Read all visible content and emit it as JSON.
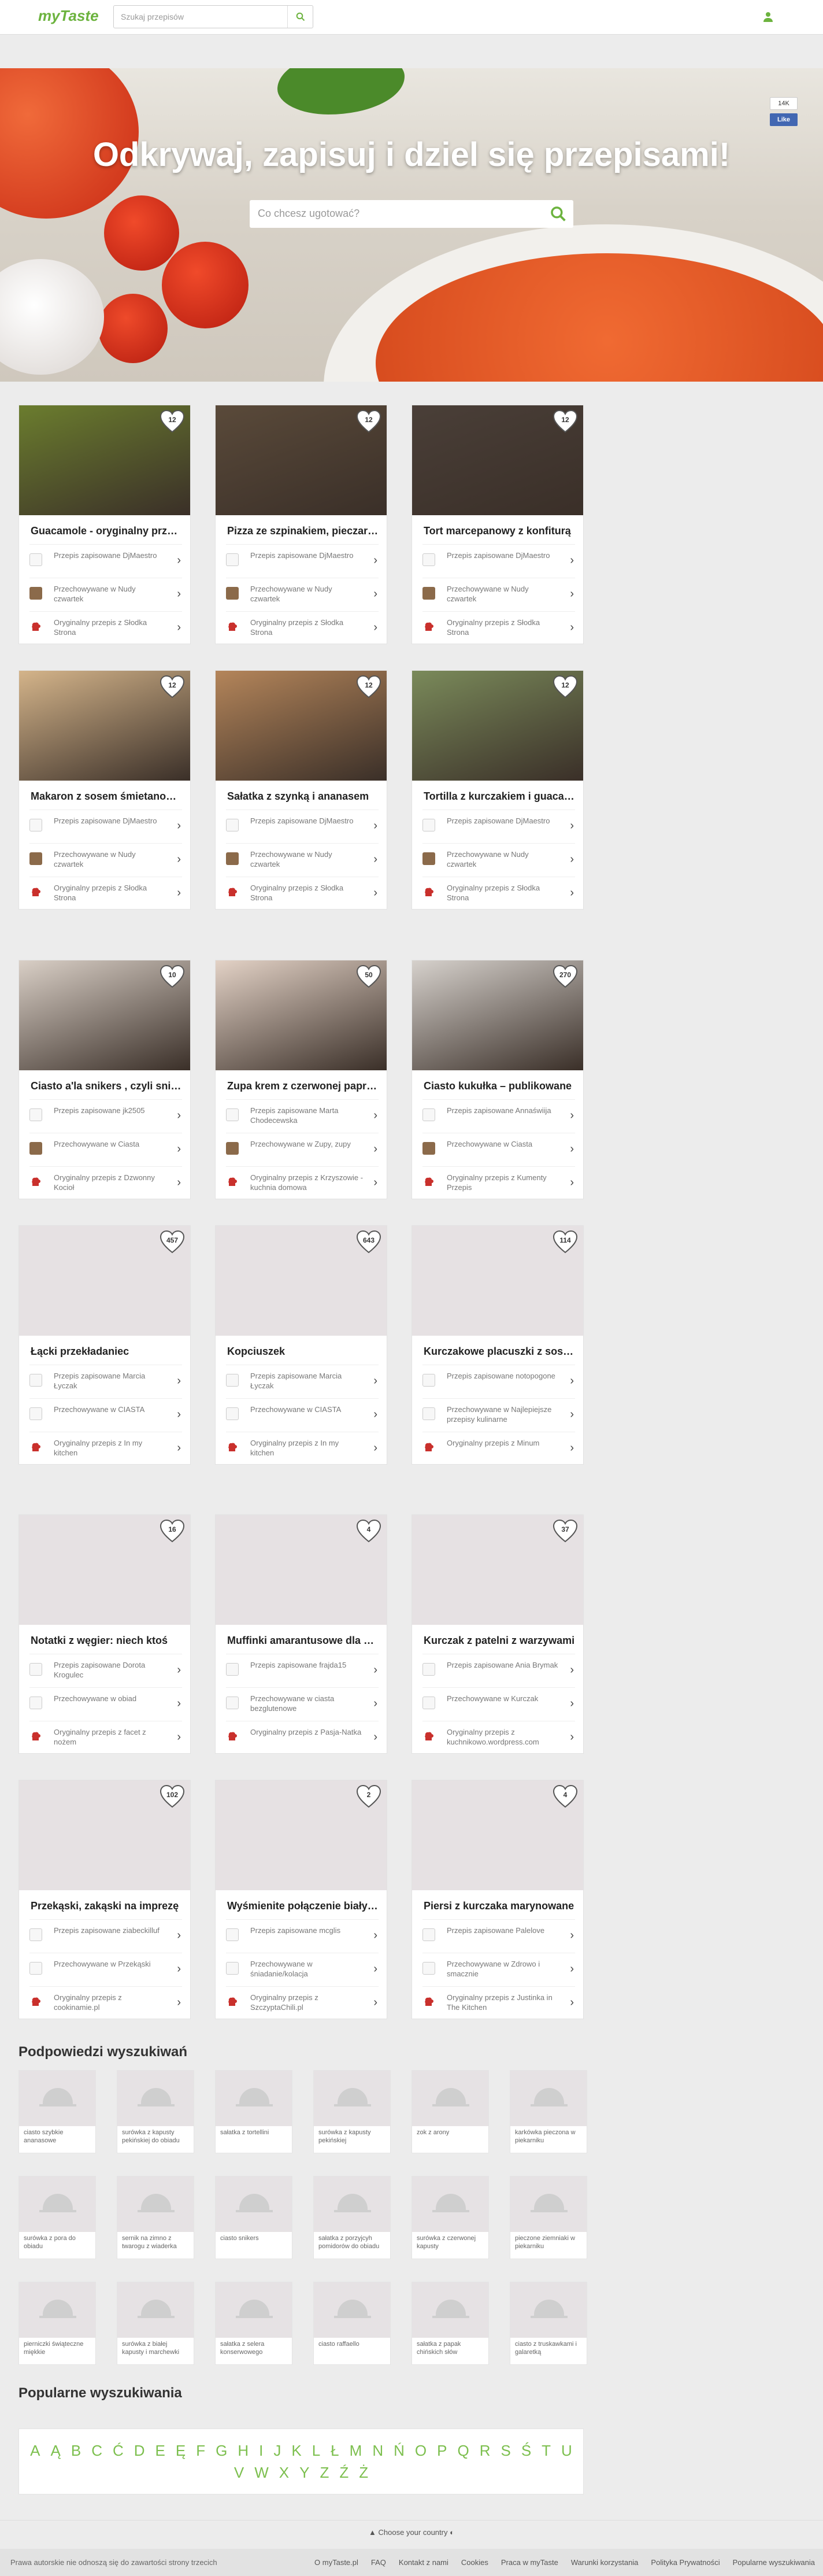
{
  "header": {
    "logo": "myTaste",
    "search_placeholder": "Szukaj przepisów"
  },
  "hero": {
    "title": "Odkrywaj, zapisuj i dziel się przepisami!",
    "search_placeholder": "Co chcesz ugotować?",
    "fb_count": "14K",
    "fb_like": "Like"
  },
  "cards": [
    {
      "likes": "12",
      "title": "Guacamole - oryginalny przepis",
      "saved_by": "Przepis zapisowane DjMaestro",
      "stored": "Przechowywane w Nudy czwartek",
      "source": "Oryginalny przepis z Słodka Strona",
      "color": "#6b7d2e"
    },
    {
      "likes": "12",
      "title": "Pizza ze szpinakiem, pieczarkami",
      "saved_by": "Przepis zapisowane DjMaestro",
      "stored": "Przechowywane w Nudy czwartek",
      "source": "Oryginalny przepis z Słodka Strona",
      "color": "#5a4a3a"
    },
    {
      "likes": "12",
      "title": "Tort marcepanowy z konfiturą",
      "saved_by": "Przepis zapisowane DjMaestro",
      "stored": "Przechowywane w Nudy czwartek",
      "source": "Oryginalny przepis z Słodka Strona",
      "color": "#4a3f38"
    },
    {
      "likes": "12",
      "title": "Makaron z sosem śmietanowym",
      "saved_by": "Przepis zapisowane DjMaestro",
      "stored": "Przechowywane w Nudy czwartek",
      "source": "Oryginalny przepis z Słodka Strona",
      "color": "#d4b48a"
    },
    {
      "likes": "12",
      "title": "Sałatka z szynką i ananasem",
      "saved_by": "Przepis zapisowane DjMaestro",
      "stored": "Przechowywane w Nudy czwartek",
      "source": "Oryginalny przepis z Słodka Strona",
      "color": "#b4855a"
    },
    {
      "likes": "12",
      "title": "Tortilla z kurczakiem i guacamole",
      "saved_by": "Przepis zapisowane DjMaestro",
      "stored": "Przechowywane w Nudy czwartek",
      "source": "Oryginalny przepis z Słodka Strona",
      "color": "#7a8a5a"
    },
    {
      "likes": "10",
      "title": "Ciasto a'la snikers , czyli snikersowe",
      "saved_by": "Przepis zapisowane jk2505",
      "stored": "Przechowywane w Ciasta",
      "source": "Oryginalny przepis z Dzwonny Kocioł",
      "color": "#d9cfc6"
    },
    {
      "likes": "50",
      "title": "Zupa krem z czerwonej papryki",
      "saved_by": "Przepis zapisowane Marta Chodecewska",
      "stored": "Przechowywane w Zupy, zupy",
      "source": "Oryginalny przepis z Krzyszowie - kuchnia domowa",
      "color": "#e3d2c6"
    },
    {
      "likes": "270",
      "title": "Ciasto kukułka – publikowane",
      "saved_by": "Przepis zapisowane Annaświija",
      "stored": "Przechowywane w Ciasta",
      "source": "Oryginalny przepis z Kumenty Przepis",
      "color": "#d6d1cc"
    },
    {
      "likes": "457",
      "title": "Łącki przekładaniec",
      "saved_by": "Przepis zapisowane Marcia Łyczak",
      "stored": "Przechowywane w CIASTA",
      "source": "Oryginalny przepis z In my kitchen",
      "color": ""
    },
    {
      "likes": "643",
      "title": "Kopciuszek",
      "saved_by": "Przepis zapisowane Marcia Łyczak",
      "stored": "Przechowywane w CIASTA",
      "source": "Oryginalny przepis z In my kitchen",
      "color": ""
    },
    {
      "likes": "114",
      "title": "Kurczakowe placuszki z sosem",
      "saved_by": "Przepis zapisowane notopogone",
      "stored": "Przechowywane w Najlepiejsze przepisy kulinarne",
      "source": "Oryginalny przepis z Minum",
      "color": ""
    },
    {
      "likes": "16",
      "title": "Notatki z węgier: niech ktoś",
      "saved_by": "Przepis zapisowane Dorota Krogulec",
      "stored": "Przechowywane w obiad",
      "source": "Oryginalny przepis z facet z nożem",
      "color": ""
    },
    {
      "likes": "4",
      "title": "Muffinki amarantusowe dla alergików",
      "saved_by": "Przepis zapisowane frajda15",
      "stored": "Przechowywane w ciasta bezglutenowe",
      "source": "Oryginalny przepis z Pasja-Natka",
      "color": ""
    },
    {
      "likes": "37",
      "title": "Kurczak z patelni z warzywami",
      "saved_by": "Przepis zapisowane Ania Brymak",
      "stored": "Przechowywane w Kurczak",
      "source": "Oryginalny przepis z kuchnikowo.wordpress.com",
      "color": ""
    },
    {
      "likes": "102",
      "title": "Przekąski, zakąski na imprezę",
      "saved_by": "Przepis zapisowane ziabeckilluf",
      "stored": "Przechowywane w Przekąski",
      "source": "Oryginalny przepis z cookinamie.pl",
      "color": ""
    },
    {
      "likes": "2",
      "title": "Wyśmienite połączenie białych",
      "saved_by": "Przepis zapisowane mcglis",
      "stored": "Przechowywane w śniadanie/kolacja",
      "source": "Oryginalny przepis z SzczyptaChili.pl",
      "color": ""
    },
    {
      "likes": "4",
      "title": "Piersi z kurczaka marynowane",
      "saved_by": "Przepis zapisowane Palelove",
      "stored": "Przechowywane w Zdrowo i smacznie",
      "source": "Oryginalny przepis z Justinka in The Kitchen",
      "color": ""
    }
  ],
  "suggestions": {
    "title": "Podpowiedzi wyszukiwań",
    "items": [
      "ciasto szybkie ananasowe",
      "surówka z kapusty pekińskiej do obiadu",
      "sałatka z tortellini",
      "surówka z kapusty pekińskiej",
      "zok z arony",
      "karkówka pieczona w piekarniku",
      "surówka z pora do obiadu",
      "sernik na zimno z twarogu z wiaderka",
      "ciasto snikers",
      "sałatka z porzyjcyh pomidorów do obiadu",
      "surówka z czerwonej kapusty",
      "pieczone ziemniaki w piekarniku",
      "pierniczki świąteczne miękkie",
      "surówka z białej kapusty i marchewki",
      "sałatka z selera konserwowego",
      "ciasto raffaello",
      "sałatka z papak chińskich słów",
      "ciasto z truskawkami i galaretką"
    ]
  },
  "popular": {
    "title": "Popularne wyszukiwania",
    "letters": [
      "A",
      "Ą",
      "B",
      "C",
      "Ć",
      "D",
      "E",
      "Ę",
      "F",
      "G",
      "H",
      "I",
      "J",
      "K",
      "L",
      "Ł",
      "M",
      "N",
      "Ń",
      "O",
      "P",
      "Q",
      "R",
      "S",
      "Ś",
      "T",
      "U",
      "V",
      "W",
      "X",
      "Y",
      "Z",
      "Ź",
      "Ż"
    ]
  },
  "footer": {
    "country": "Choose your country",
    "disclaimer": "Prawa autorskie nie odnoszą się do zawartości strony trzecich",
    "links": [
      "O myTaste.pl",
      "FAQ",
      "Kontakt z nami",
      "Cookies",
      "Praca w myTaste",
      "Warunki korzystania",
      "Polityka Prywatności",
      "Popularne wyszukiwania"
    ]
  }
}
